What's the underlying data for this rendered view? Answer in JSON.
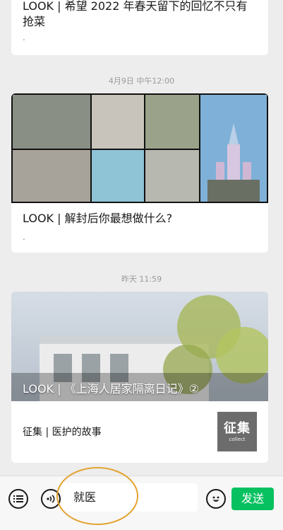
{
  "messages": [
    {
      "title": "LOOK | 希望 2022 年春天留下的回忆不只有抢菜",
      "desc": "."
    },
    {
      "time": "4月9日 中午12:00",
      "title": "LOOK | 解封后你最想做什么?",
      "desc": "."
    },
    {
      "time": "昨天 11:59",
      "banner_title": "LOOK | 《上海人居家隔离日记》②",
      "sub_title": "征集 | 医护的故事",
      "thumb_text": "征集",
      "thumb_sub": "collect"
    }
  ],
  "input": {
    "value": "就医"
  },
  "send_label": "发送",
  "icons": {
    "menu": "list-icon",
    "voice": "voice-icon",
    "emoji": "emoji-icon"
  },
  "colors": {
    "send": "#07c160",
    "highlight_ring": "#e3a32e"
  }
}
